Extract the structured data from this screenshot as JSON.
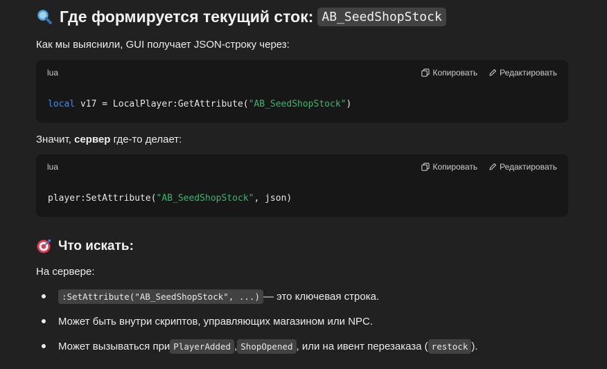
{
  "heading1": {
    "emoji": "magnifier-icon",
    "text": "Где формируется текущий сток:",
    "code": "AB_SeedShopStock"
  },
  "intro": "Как мы выяснили, GUI получает JSON-строку через:",
  "code_blocks": [
    {
      "lang": "lua",
      "copy_label": "Копировать",
      "edit_label": "Редактировать",
      "code": {
        "keyword": "local",
        "before_string": " v17 = LocalPlayer:GetAttribute(",
        "string": "\"AB_SeedShopStock\"",
        "after_string": ")"
      }
    },
    {
      "lang": "lua",
      "copy_label": "Копировать",
      "edit_label": "Редактировать",
      "code": {
        "keyword": "",
        "before_string": "player:SetAttribute(",
        "string": "\"AB_SeedShopStock\"",
        "after_string": ", json)"
      }
    }
  ],
  "mid_text": {
    "before": "Значит, ",
    "bold": "сервер",
    "after": " где-то делает:"
  },
  "heading2": {
    "emoji": "target-icon",
    "text": "Что искать:"
  },
  "server_label": "На сервере:",
  "bullets": [
    {
      "code": ":SetAttribute(\"AB_SeedShopStock\", ...)",
      "text": " — это ключевая строка."
    },
    {
      "text": "Может быть внутри скриптов, управляющих магазином или NPC."
    },
    {
      "text_before": "Может вызываться при ",
      "code1": "PlayerAdded",
      "sep1": ", ",
      "code2": "ShopOpened",
      "text_mid": ", или на ивент перезаказа (",
      "code3": "restock",
      "text_after": ")."
    }
  ]
}
